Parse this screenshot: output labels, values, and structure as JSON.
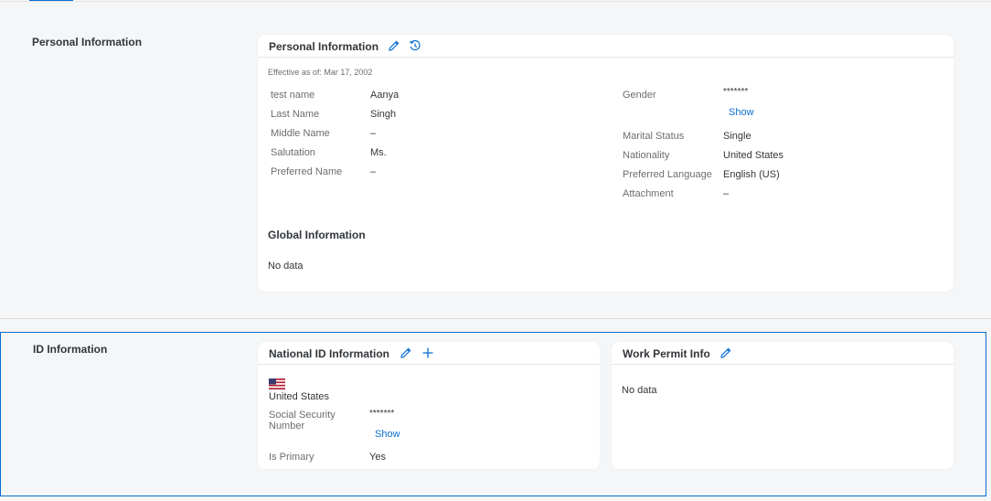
{
  "colors": {
    "accent": "#0a6ed1",
    "background": "#f5f6f7",
    "card": "#ffffff"
  },
  "personal_section": {
    "title": "Personal Information",
    "card": {
      "title": "Personal Information",
      "edit_icon": "pencil-icon",
      "history_icon": "history-icon",
      "effective": "Effective as of: Mar 17, 2002",
      "left_fields": [
        {
          "label": "test name",
          "value": "Aanya"
        },
        {
          "label": "Last Name",
          "value": "Singh"
        },
        {
          "label": "Middle Name",
          "value": "–"
        },
        {
          "label": "Salutation",
          "value": "Ms."
        },
        {
          "label": "Preferred Name",
          "value": "–"
        }
      ],
      "gender": {
        "label": "Gender",
        "value": "*******",
        "show_label": "Show"
      },
      "right_fields": [
        {
          "label": "Marital Status",
          "value": "Single"
        },
        {
          "label": "Nationality",
          "value": "United States"
        },
        {
          "label": "Preferred Language",
          "value": "English (US)"
        },
        {
          "label": "Attachment",
          "value": "–"
        }
      ],
      "global_title": "Global Information",
      "global_value": "No data"
    }
  },
  "id_section": {
    "title": "ID Information",
    "national_card": {
      "title": "National ID Information",
      "edit_icon": "pencil-icon",
      "add_icon": "plus-icon",
      "country": "United States",
      "flag_icon": "us-flag-icon",
      "ssn_label": "Social Security Number",
      "ssn_value": "*******",
      "show_label": "Show",
      "primary_label": "Is Primary",
      "primary_value": "Yes"
    },
    "work_permit_card": {
      "title": "Work Permit Info",
      "edit_icon": "pencil-icon",
      "value": "No data"
    }
  }
}
